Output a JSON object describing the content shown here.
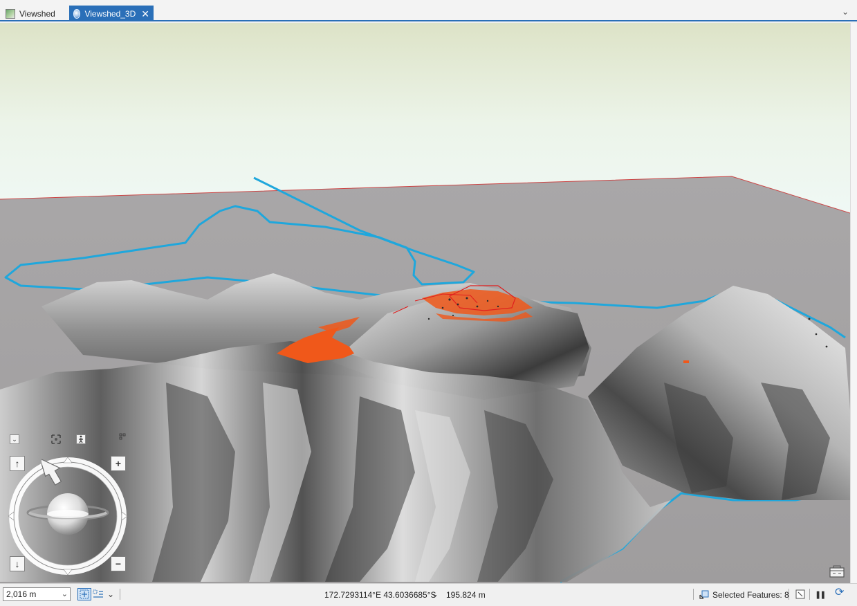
{
  "tabs": [
    {
      "label": "Viewshed",
      "icon": "map-icon",
      "active": false
    },
    {
      "label": "Viewshed_3D",
      "icon": "globe-icon",
      "active": true
    }
  ],
  "tab_close_glyph": "✕",
  "tab_overflow_glyph": "⌄",
  "navigator": {
    "up_glyph": "↑",
    "down_glyph": "↓",
    "zoom_in_glyph": "+",
    "zoom_out_glyph": "−",
    "collapse_glyph": "⌄"
  },
  "statusbar": {
    "scale": "2,016 m",
    "scale_chevron": "⌄",
    "nav_mode_chevron": "⌄",
    "coordinates": "172.7293114°E 43.6036685°S",
    "coordinates_chevron": "⌄",
    "elevation": "195.824 m",
    "selected_features": "Selected Features: 8",
    "pause_glyph": "❚❚",
    "refresh_glyph": "⟳"
  },
  "colors": {
    "accent": "#2a6fb8",
    "viewshed_orange": "#f0581a",
    "river_blue": "#1fa7dc",
    "observer_red": "#e01e1e"
  }
}
